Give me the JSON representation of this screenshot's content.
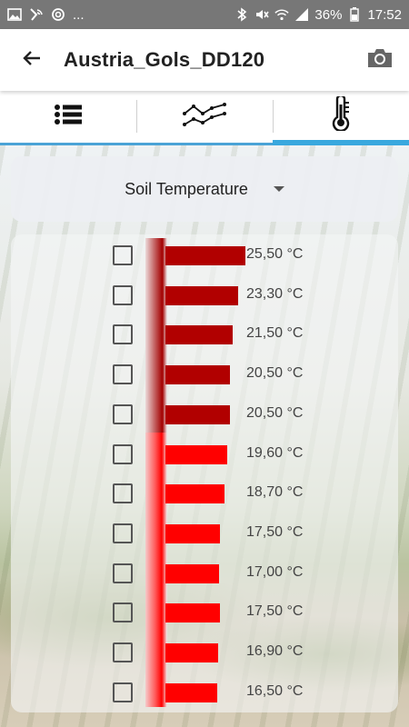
{
  "status_bar": {
    "left_icons": [
      "image-icon",
      "broadcast-icon",
      "sync-circle-icon"
    ],
    "left_more": "...",
    "right_icons": [
      "bluetooth-icon",
      "mute-icon",
      "wifi-icon",
      "signal-icon"
    ],
    "battery": "36%",
    "time": "17:52"
  },
  "app_bar": {
    "back_icon": "arrow-left-icon",
    "title": "Austria_Gols_DD120",
    "camera_icon": "camera-icon"
  },
  "tabs": [
    {
      "name": "list",
      "icon": "list-icon",
      "active": false
    },
    {
      "name": "chart",
      "icon": "line-chart-icon",
      "active": false
    },
    {
      "name": "temperature",
      "icon": "thermometer-icon",
      "active": true
    }
  ],
  "dropdown": {
    "selected": "Soil Temperature"
  },
  "readings": [
    {
      "value": 25.5,
      "label": "25,50 °C",
      "checked": false,
      "color": "#b10000"
    },
    {
      "value": 23.3,
      "label": "23,30 °C",
      "checked": false,
      "color": "#b10000"
    },
    {
      "value": 21.5,
      "label": "21,50 °C",
      "checked": false,
      "color": "#b10000"
    },
    {
      "value": 20.5,
      "label": "20,50 °C",
      "checked": false,
      "color": "#b10000"
    },
    {
      "value": 20.5,
      "label": "20,50 °C",
      "checked": false,
      "color": "#b10000"
    },
    {
      "value": 19.6,
      "label": "19,60 °C",
      "checked": false,
      "color": "#ff0000"
    },
    {
      "value": 18.7,
      "label": "18,70 °C",
      "checked": false,
      "color": "#ff0000"
    },
    {
      "value": 17.5,
      "label": "17,50 °C",
      "checked": false,
      "color": "#ff0000"
    },
    {
      "value": 17.0,
      "label": "17,00 °C",
      "checked": false,
      "color": "#ff0000"
    },
    {
      "value": 17.5,
      "label": "17,50 °C",
      "checked": false,
      "color": "#ff0000"
    },
    {
      "value": 16.9,
      "label": "16,90 °C",
      "checked": false,
      "color": "#ff0000"
    },
    {
      "value": 16.5,
      "label": "16,50 °C",
      "checked": false,
      "color": "#ff0000"
    }
  ],
  "colors": {
    "accent": "#39a8de",
    "status_bar": "#777777",
    "warm": "#b10000",
    "hot": "#ff0000"
  }
}
